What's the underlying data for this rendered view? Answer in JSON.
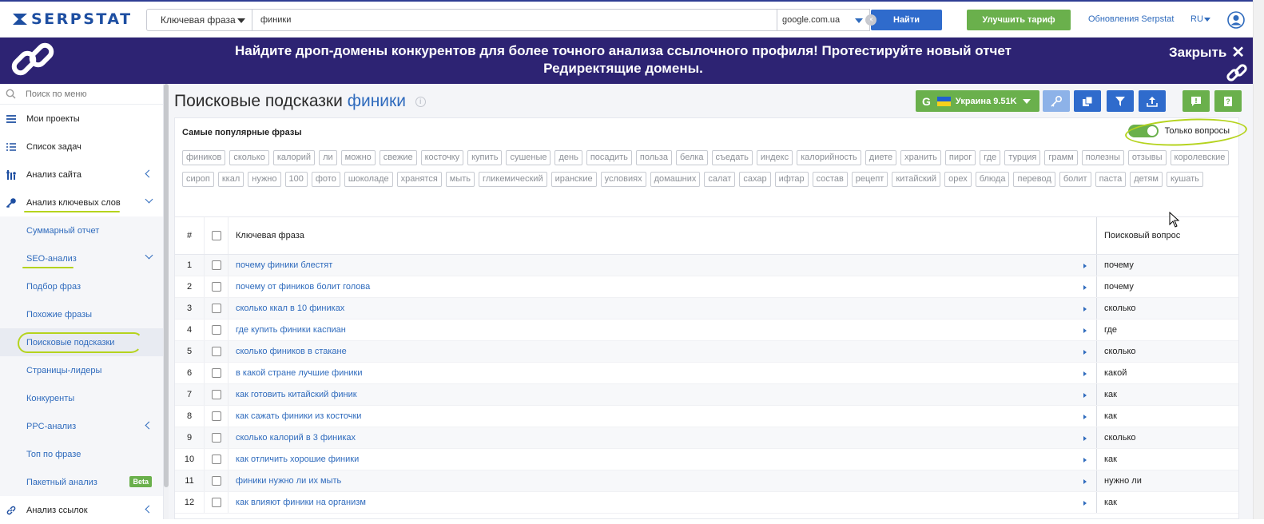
{
  "app": {
    "logo_text": "SERPSTAT"
  },
  "topbar": {
    "search_type": "Ключевая фраза",
    "query": "финики",
    "database": "google.com.ua",
    "find_label": "Найти",
    "upgrade_label": "Улучшить тариф",
    "updates_link": "Обновления Serpstat",
    "lang": "RU"
  },
  "banner": {
    "line1": "Найдите дроп-домены конкурентов для более точного анализа ссылочного профиля! Протестируйте новый отчет",
    "line2": "Редиректящие домены.",
    "close_label": "Закрыть"
  },
  "sidebar": {
    "search_placeholder": "Поиск по меню",
    "items": [
      {
        "label": "Мои проекты",
        "icon": "menu-icon"
      },
      {
        "label": "Список задач",
        "icon": "list-icon"
      },
      {
        "label": "Анализ сайта",
        "icon": "site-analysis-icon"
      },
      {
        "label": "Анализ ключевых слов",
        "icon": "key-icon"
      },
      {
        "label": "Суммарный отчет"
      },
      {
        "label": "SEO-анализ"
      },
      {
        "label": "Подбор фраз"
      },
      {
        "label": "Похожие фразы"
      },
      {
        "label": "Поисковые подсказки"
      },
      {
        "label": "Страницы-лидеры"
      },
      {
        "label": "Конкуренты"
      },
      {
        "label": "PPC-анализ"
      },
      {
        "label": "Топ по фразе"
      },
      {
        "label": "Пакетный анализ",
        "badge": "Beta"
      },
      {
        "label": "Анализ ссылок",
        "icon": "link-icon"
      }
    ]
  },
  "main": {
    "title": "Поисковые подсказки",
    "title_keyword": "финики",
    "region_button": {
      "engine": "G",
      "label": "Украина 9.51K"
    },
    "popular": {
      "title": "Самые популярные фразы",
      "toggle_label": "Только вопросы",
      "toggle_on": true,
      "tags": [
        "фиников",
        "сколько",
        "калорий",
        "ли",
        "можно",
        "свежие",
        "косточку",
        "купить",
        "сушеные",
        "день",
        "посадить",
        "польза",
        "белка",
        "съедать",
        "индекс",
        "калорийность",
        "диете",
        "хранить",
        "пирог",
        "где",
        "турция",
        "грамм",
        "полезны",
        "отзывы",
        "королевские",
        "сироп",
        "ккал",
        "нужно",
        "100",
        "фото",
        "шоколаде",
        "хранятся",
        "мыть",
        "гликемический",
        "иранские",
        "условиях",
        "домашних",
        "салат",
        "сахар",
        "ифтар",
        "состав",
        "рецепт",
        "китайский",
        "орех",
        "блюда",
        "перевод",
        "болит",
        "паста",
        "детям",
        "кушать"
      ]
    },
    "table": {
      "headers": {
        "num": "#",
        "keyword": "Ключевая фраза",
        "question": "Поисковый вопрос"
      },
      "rows": [
        {
          "n": "1",
          "kw": "почему финики блестят",
          "q": "почему"
        },
        {
          "n": "2",
          "kw": "почему от фиников болит голова",
          "q": "почему"
        },
        {
          "n": "3",
          "kw": "сколько ккал в 10 финиках",
          "q": "сколько"
        },
        {
          "n": "4",
          "kw": "где купить финики каспиан",
          "q": "где"
        },
        {
          "n": "5",
          "kw": "сколько фиников в стакане",
          "q": "сколько"
        },
        {
          "n": "6",
          "kw": "в какой стране лучшие финики",
          "q": "какой"
        },
        {
          "n": "7",
          "kw": "как готовить китайский финик",
          "q": "как"
        },
        {
          "n": "8",
          "kw": "как сажать финики из косточки",
          "q": "как"
        },
        {
          "n": "9",
          "kw": "сколько калорий в 3 финиках",
          "q": "сколько"
        },
        {
          "n": "10",
          "kw": "как отличить хорошие финики",
          "q": "как"
        },
        {
          "n": "11",
          "kw": "финики нужно ли их мыть",
          "q": "нужно ли"
        },
        {
          "n": "12",
          "kw": "как влияют финики на организм",
          "q": "как"
        }
      ]
    }
  },
  "colors": {
    "brand_blue": "#2f6bcc",
    "green": "#6ab04c",
    "banner": "#2d2373",
    "highlight": "#b5d31e"
  }
}
